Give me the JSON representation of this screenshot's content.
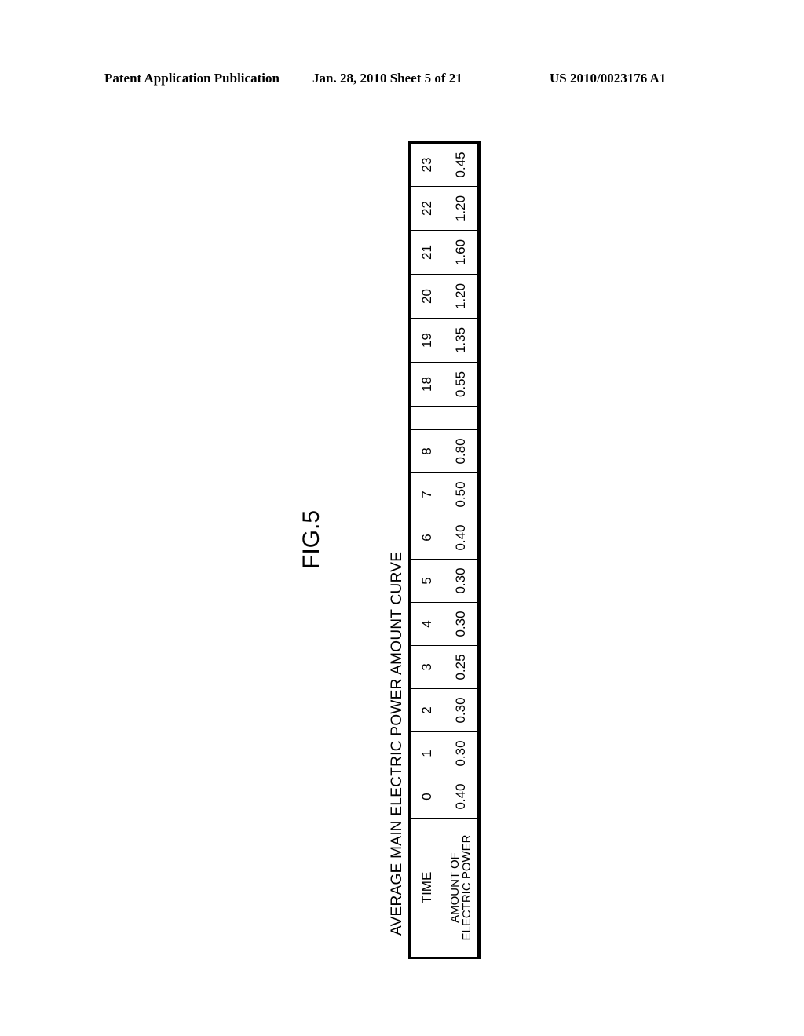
{
  "header": {
    "left": "Patent Application Publication",
    "middle": "Jan. 28, 2010  Sheet 5 of 21",
    "right": "US 2010/0023176 A1"
  },
  "figure": {
    "label": "FIG.5",
    "title": "AVERAGE MAIN ELECTRIC POWER AMOUNT CURVE"
  },
  "table": {
    "row_labels": [
      "TIME",
      "AMOUNT OF ELECTRIC POWER"
    ],
    "row_label_lines": [
      "AMOUNT OF",
      "ELECTRIC POWER"
    ],
    "times_left": [
      "0",
      "1",
      "2",
      "3",
      "4",
      "5",
      "6",
      "7",
      "8"
    ],
    "values_left": [
      "0.40",
      "0.30",
      "0.30",
      "0.25",
      "0.30",
      "0.30",
      "0.40",
      "0.50",
      "0.80"
    ],
    "times_right": [
      "18",
      "19",
      "20",
      "21",
      "22",
      "23"
    ],
    "values_right": [
      "0.55",
      "1.35",
      "1.20",
      "1.60",
      "1.20",
      "0.45"
    ]
  },
  "chart_data": {
    "type": "table",
    "title": "AVERAGE MAIN ELECTRIC POWER AMOUNT CURVE",
    "columns": [
      "TIME",
      "AMOUNT OF ELECTRIC POWER"
    ],
    "x": [
      0,
      1,
      2,
      3,
      4,
      5,
      6,
      7,
      8,
      18,
      19,
      20,
      21,
      22,
      23
    ],
    "values": [
      0.4,
      0.3,
      0.3,
      0.25,
      0.3,
      0.3,
      0.4,
      0.5,
      0.8,
      0.55,
      1.35,
      1.2,
      1.6,
      1.2,
      0.45
    ],
    "annotations": [
      "break between time 8 and 18"
    ]
  }
}
